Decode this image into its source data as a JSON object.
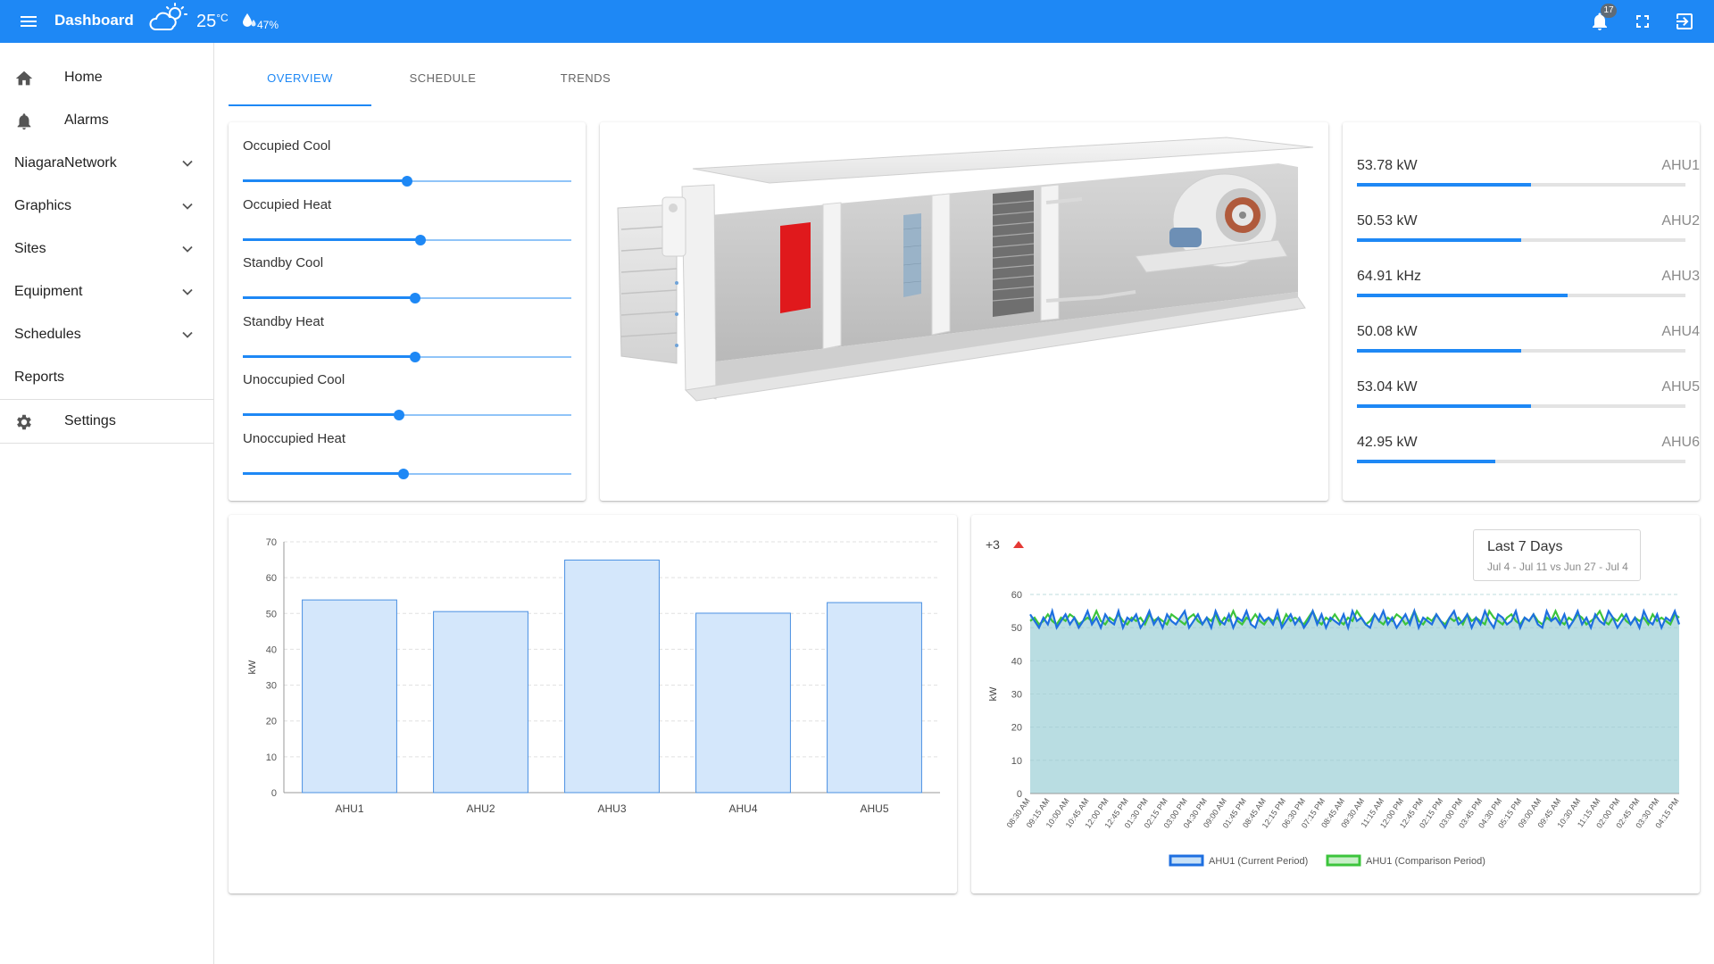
{
  "header": {
    "title": "Dashboard",
    "temperature": "25",
    "temp_unit": "°C",
    "humidity": "47%",
    "notification_count": "17",
    "bar_color": "#1e88f5"
  },
  "sidebar": {
    "home": "Home",
    "alarms": "Alarms",
    "niagara": "NiagaraNetwork",
    "graphics": "Graphics",
    "sites": "Sites",
    "equipment": "Equipment",
    "schedules": "Schedules",
    "reports": "Reports",
    "settings": "Settings"
  },
  "tabs": {
    "overview": "OVERVIEW",
    "schedule": "SCHEDULE",
    "trends": "TRENDS",
    "active": "overview"
  },
  "setpoints": [
    {
      "label": "Occupied Cool",
      "value": 0.5
    },
    {
      "label": "Occupied Heat",
      "value": 0.54
    },
    {
      "label": "Standby Cool",
      "value": 0.525
    },
    {
      "label": "Standby Heat",
      "value": 0.525
    },
    {
      "label": "Unoccupied Cool",
      "value": 0.475
    },
    {
      "label": "Unoccupied Heat",
      "value": 0.488
    }
  ],
  "meters": [
    {
      "value": "53.78 kW",
      "name": "AHU1",
      "level": 0.53
    },
    {
      "value": "50.53 kW",
      "name": "AHU2",
      "level": 0.5
    },
    {
      "value": "64.91 kHz",
      "name": "AHU3",
      "level": 0.64
    },
    {
      "value": "50.08 kW",
      "name": "AHU4",
      "level": 0.5
    },
    {
      "value": "53.04 kW",
      "name": "AHU5",
      "level": 0.53
    },
    {
      "value": "42.95 kW",
      "name": "AHU6",
      "level": 0.42
    }
  ],
  "trend": {
    "delta": "+3",
    "range_title": "Last 7 Days",
    "range_sub": "Jul 4 - Jul 11 vs Jun 27 - Jul 4"
  },
  "chart_data": [
    {
      "type": "bar",
      "categories": [
        "AHU1",
        "AHU2",
        "AHU3",
        "AHU4",
        "AHU5"
      ],
      "values": [
        53.78,
        50.53,
        64.91,
        50.08,
        53.04
      ],
      "ylabel": "kW",
      "ylim": [
        0,
        70
      ],
      "yticks": [
        0,
        10,
        20,
        30,
        40,
        50,
        60,
        70
      ],
      "grid": true,
      "bar_color": "#d4e7fb",
      "bar_border": "#4a90e2"
    },
    {
      "type": "line",
      "ylabel": "kW",
      "ylim": [
        0,
        60
      ],
      "yticks": [
        0,
        10,
        20,
        30,
        40,
        50,
        60
      ],
      "grid": true,
      "legend_position": "bottom",
      "area_color": "#b9dde2",
      "x": [
        "08:30 AM",
        "09:15 AM",
        "10:00 AM",
        "10:45 AM",
        "12:00 PM",
        "12:45 PM",
        "01:30 PM",
        "02:15 PM",
        "03:00 PM",
        "04:30 PM",
        "09:00 AM",
        "01:45 PM",
        "08:45 AM",
        "12:15 PM",
        "06:30 PM",
        "07:15 PM",
        "08:45 AM",
        "09:30 AM",
        "11:15 AM",
        "12:00 PM",
        "12:45 PM",
        "02:15 PM",
        "03:00 PM",
        "03:45 PM",
        "04:30 PM",
        "05:15 PM",
        "09:00 AM",
        "09:45 AM",
        "10:30 AM",
        "11:15 AM",
        "02:00 PM",
        "02:45 PM",
        "03:30 PM",
        "04:15 PM"
      ],
      "series": [
        {
          "name": "AHU1 (Current Period)",
          "color": "#1e6fe0",
          "values": [
            54,
            52,
            50,
            53,
            51,
            55,
            50,
            52,
            54,
            51,
            53,
            50,
            52,
            55,
            51,
            53,
            50,
            54,
            52,
            51,
            55,
            50,
            53,
            52,
            54,
            50,
            52,
            55,
            51,
            53,
            50,
            54,
            52,
            51,
            53,
            55,
            50,
            52,
            54,
            51,
            53,
            50,
            55,
            52,
            51,
            54,
            50,
            53,
            52,
            55,
            51,
            50,
            54,
            52,
            53,
            51,
            55,
            50,
            52,
            54,
            51,
            53,
            50,
            52,
            55,
            51,
            54,
            50,
            53,
            52,
            51,
            54,
            50,
            55,
            52,
            53,
            51,
            50,
            54,
            52,
            55,
            51,
            53,
            50,
            52,
            54,
            51,
            55,
            50,
            53,
            52,
            51,
            54,
            52,
            50,
            53,
            55,
            51,
            52,
            54,
            50,
            53,
            51,
            55,
            52,
            50,
            54,
            53,
            51,
            52,
            55,
            50,
            53,
            52,
            54,
            51,
            50,
            55,
            52,
            53,
            51,
            54,
            50,
            52,
            55,
            51,
            53,
            50,
            54,
            52,
            51,
            55,
            53,
            50,
            52,
            54,
            51,
            53,
            50,
            55,
            52,
            51,
            54,
            50,
            53,
            52,
            55,
            51
          ]
        },
        {
          "name": "AHU1 (Comparison Period)",
          "color": "#3cc43c",
          "values": [
            52,
            53,
            51,
            52,
            54,
            52,
            51,
            53,
            52,
            54,
            53,
            51,
            52,
            53,
            52,
            55,
            52,
            51,
            53,
            52,
            54,
            52,
            51,
            53,
            52,
            53,
            51,
            54,
            52,
            53,
            52,
            51,
            54,
            53,
            52,
            51,
            53,
            54,
            52,
            51,
            53,
            52,
            54,
            51,
            53,
            52,
            55,
            52,
            51,
            53,
            52,
            54,
            52,
            51,
            53,
            52,
            53,
            51,
            54,
            52,
            53,
            52,
            51,
            53,
            55,
            52,
            51,
            53,
            52,
            54,
            52,
            51,
            53,
            52,
            55,
            53,
            51,
            52,
            54,
            52,
            51,
            53,
            52,
            54,
            53,
            51,
            52,
            55,
            52,
            51,
            53,
            52,
            54,
            52,
            51,
            53,
            52,
            53,
            51,
            54,
            52,
            53,
            52,
            51,
            55,
            53,
            52,
            51,
            53,
            54,
            52,
            51,
            53,
            52,
            54,
            52,
            51,
            53,
            52,
            55,
            52,
            51,
            53,
            52,
            54,
            53,
            51,
            52,
            53,
            55,
            52,
            51,
            53,
            52,
            54,
            52,
            51,
            53,
            52,
            53,
            51,
            54,
            52,
            53,
            52,
            51,
            54,
            53
          ]
        }
      ]
    }
  ]
}
